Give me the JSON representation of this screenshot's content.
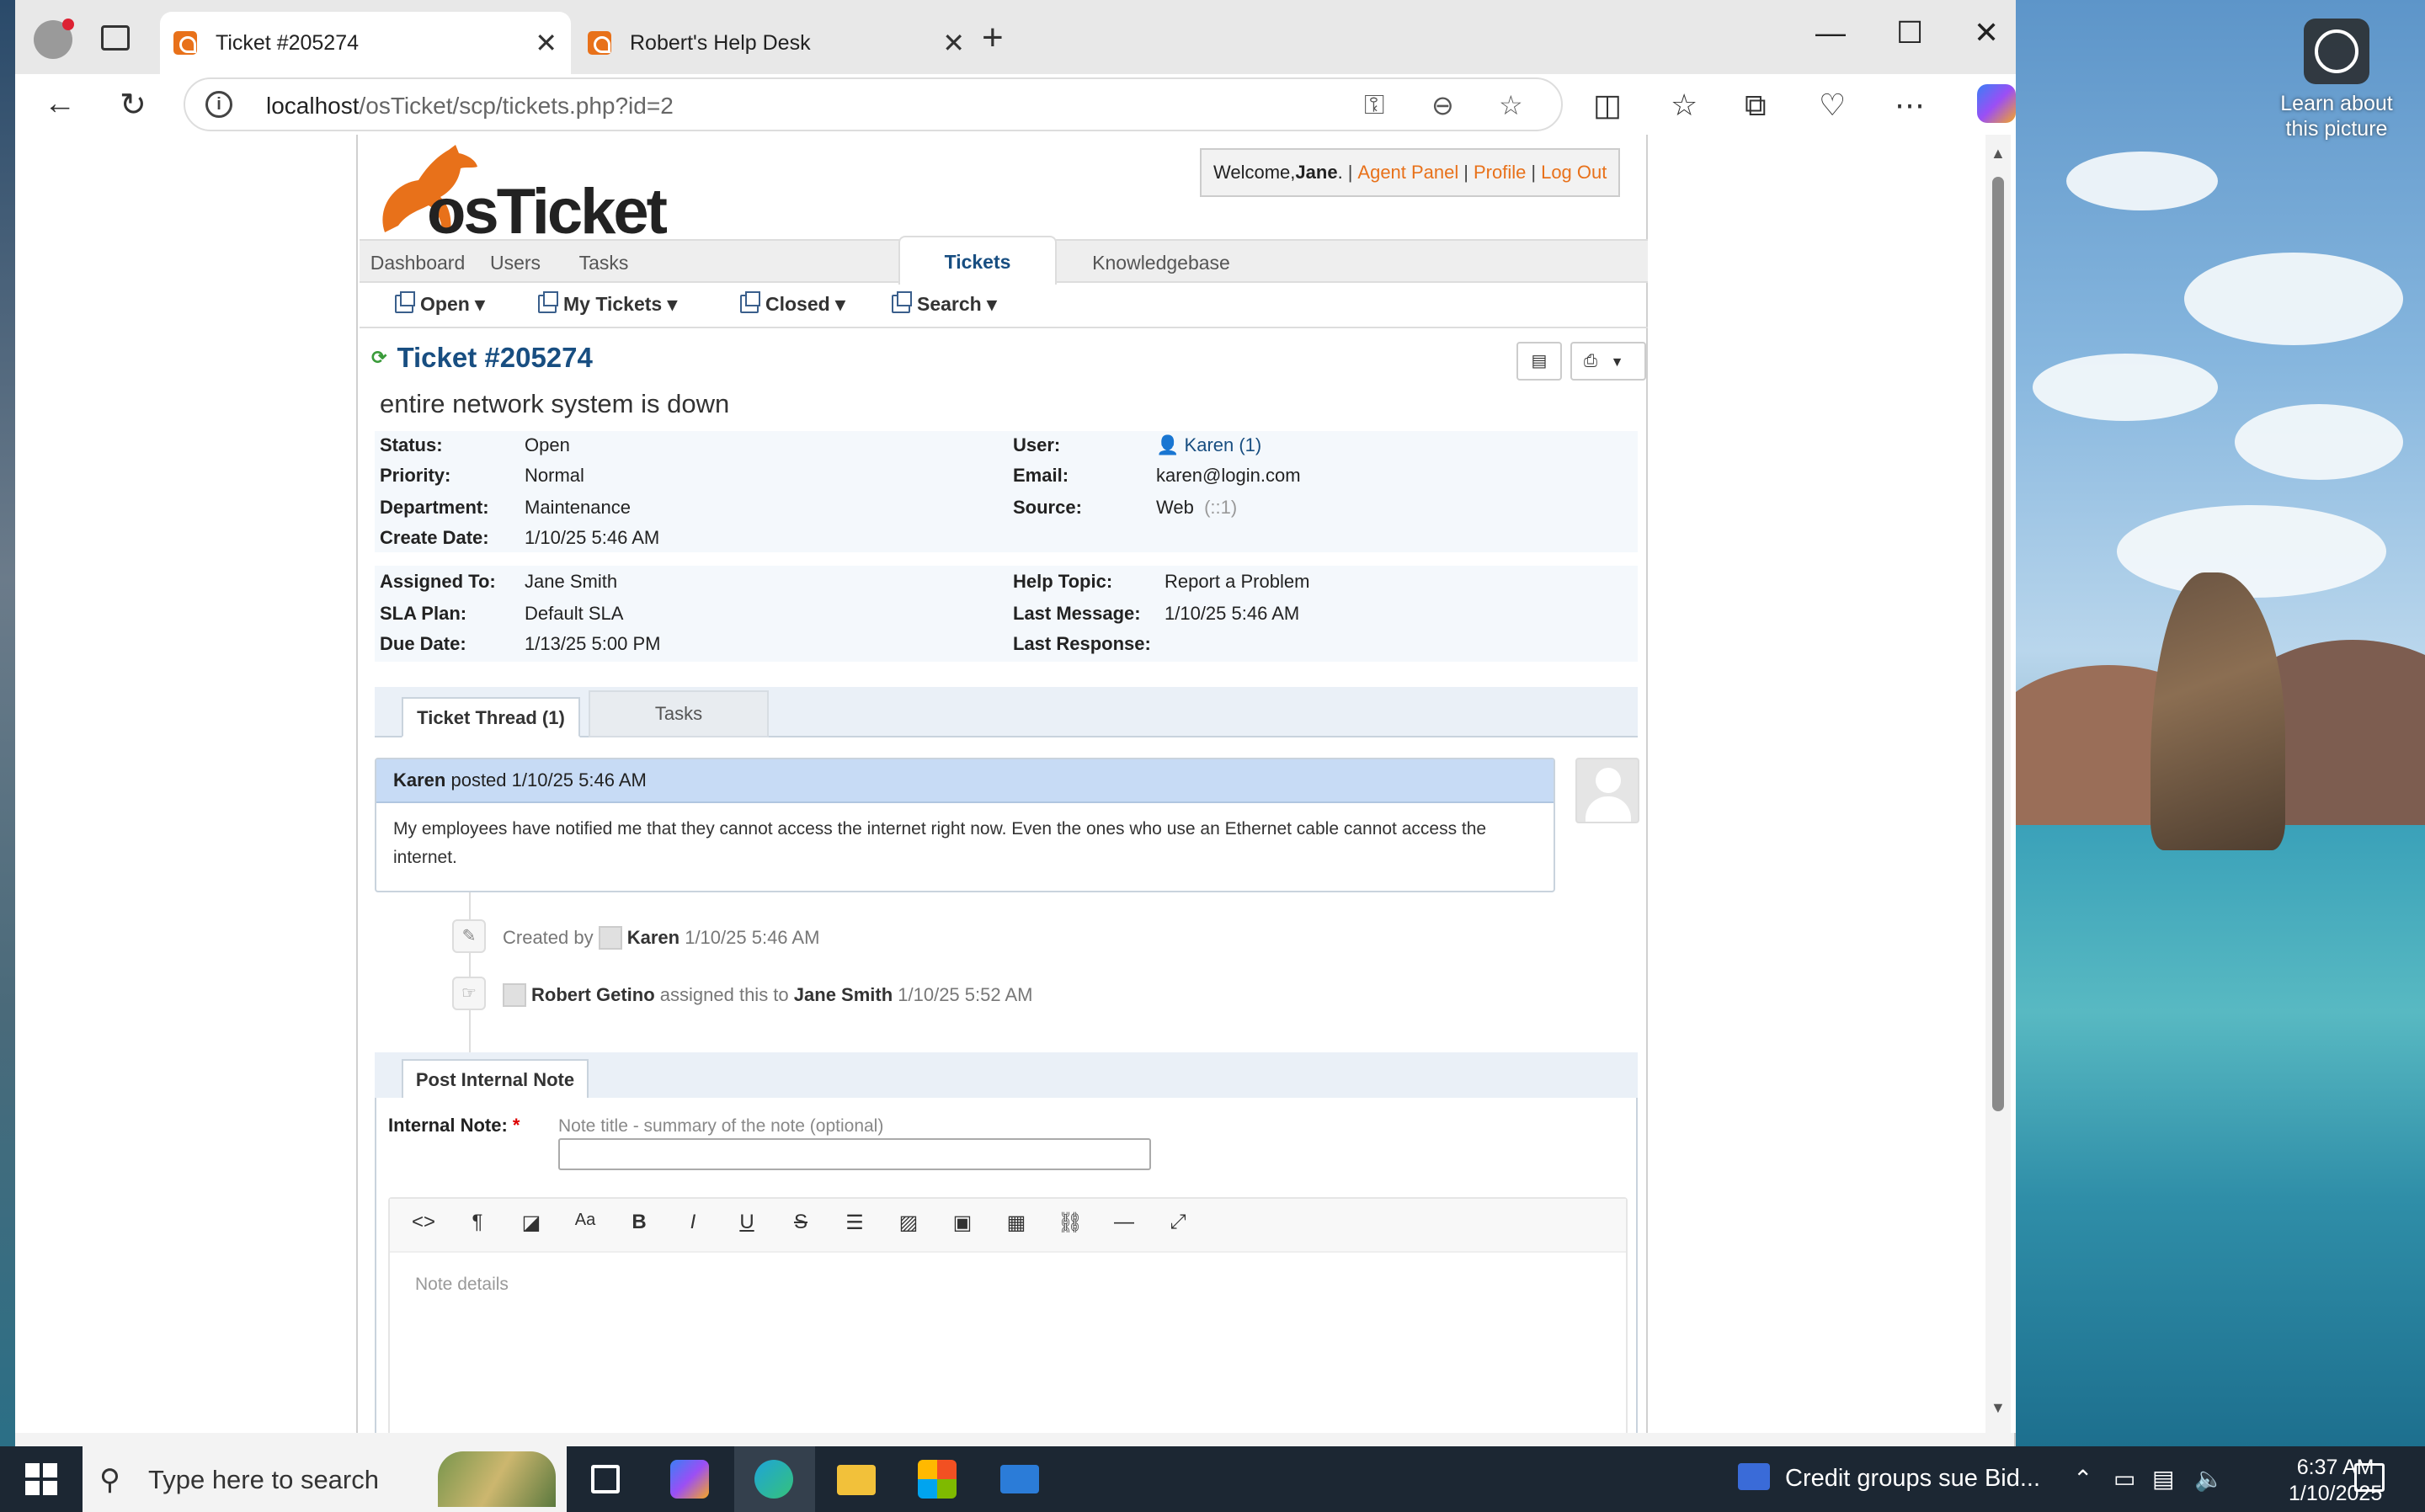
{
  "browser": {
    "tabs": [
      {
        "title": "Ticket #205274",
        "active": true
      },
      {
        "title": "Robert's Help Desk",
        "active": false
      }
    ],
    "url_host": "localhost",
    "url_path": "/osTicket/scp/tickets.php?id=2"
  },
  "desktop": {
    "learn_about": "Learn about this picture"
  },
  "header": {
    "welcome_prefix": "Welcome, ",
    "user_name": "Jane",
    "welcome_suffix": ".",
    "agent_panel": "Agent Panel",
    "profile": "Profile",
    "logout": "Log Out",
    "logo_text": "osTicket"
  },
  "mainnav": [
    "Dashboard",
    "Users",
    "Tasks",
    "Tickets",
    "Knowledgebase"
  ],
  "subnav": [
    "Open",
    "My Tickets",
    "Closed",
    "Search"
  ],
  "ticket": {
    "number": "Ticket #205274",
    "subject": "entire network system is down",
    "left1": [
      {
        "label": "Status:",
        "value": "Open"
      },
      {
        "label": "Priority:",
        "value": "Normal"
      },
      {
        "label": "Department:",
        "value": "Maintenance"
      },
      {
        "label": "Create Date:",
        "value": "1/10/25 5:46 AM"
      }
    ],
    "right1": {
      "user_label": "User:",
      "user_value": "Karen (1)",
      "email_label": "Email:",
      "email_value": "karen@login.com",
      "source_label": "Source:",
      "source_value": "Web",
      "source_ip": "(::1)"
    },
    "left2": [
      {
        "label": "Assigned To:",
        "value": "Jane Smith"
      },
      {
        "label": "SLA Plan:",
        "value": "Default SLA"
      },
      {
        "label": "Due Date:",
        "value": "1/13/25 5:00 PM"
      }
    ],
    "right2": [
      {
        "label": "Help Topic:",
        "value": "Report a Problem"
      },
      {
        "label": "Last Message:",
        "value": "1/10/25 5:46 AM"
      },
      {
        "label": "Last Response:",
        "value": ""
      }
    ]
  },
  "thread_tabs": [
    "Ticket Thread (1)",
    "Tasks"
  ],
  "message": {
    "author": "Karen",
    "posted": " posted 1/10/25 5:46 AM",
    "body": "My employees have notified me that they cannot access the internet right now. Even the ones who use an Ethernet cable cannot access the internet."
  },
  "events": [
    {
      "prefix": "Created by ",
      "actor": "Karen",
      "mid": "",
      "target": "",
      "time": " 1/10/25 5:46 AM"
    },
    {
      "prefix": "",
      "actor": "Robert Getino",
      "mid": " assigned this to ",
      "target": "Jane Smith",
      "time": " 1/10/25 5:52 AM"
    }
  ],
  "note": {
    "tab": "Post Internal Note",
    "label": "Internal Note:",
    "required_mark": "*",
    "title_hint": "Note title - summary of the note (optional)",
    "details_placeholder": "Note details"
  },
  "taskbar": {
    "search_placeholder": "Type here to search",
    "news": "Credit groups sue Bid...",
    "time": "6:37 AM",
    "date": "1/10/2025"
  }
}
